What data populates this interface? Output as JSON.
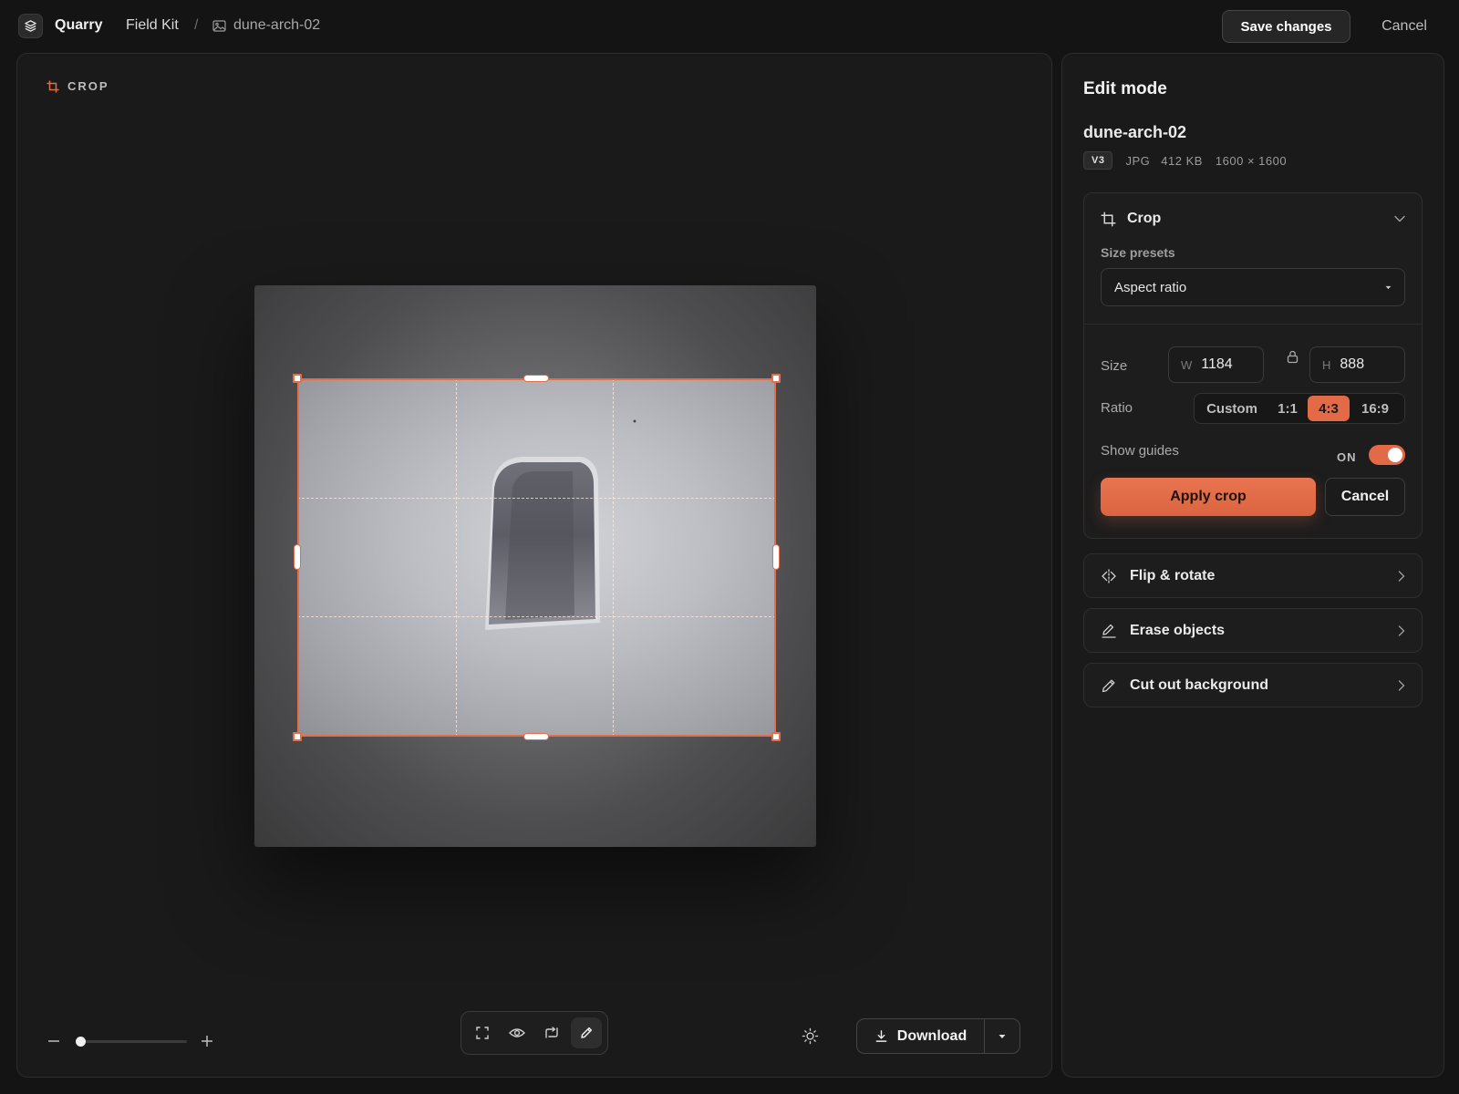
{
  "header": {
    "app_name": "Quarry",
    "project": "Field Kit",
    "separator": "/",
    "file": "dune-arch-02",
    "save_label": "Save changes",
    "cancel_label": "Cancel"
  },
  "canvas": {
    "mode_label": "CROP",
    "zoom_level": 0.0,
    "toolbar": [
      {
        "icon": "fit-screen-icon",
        "active": false
      },
      {
        "icon": "eye-icon",
        "active": false
      },
      {
        "icon": "compare-icon",
        "active": false
      },
      {
        "icon": "pen-icon",
        "active": true
      }
    ],
    "download_label": "Download"
  },
  "panel": {
    "title": "Edit mode",
    "file_name": "dune-arch-02",
    "version": "V3",
    "format": "JPG",
    "size": "412 KB",
    "dimensions": "1600 × 1600",
    "crop": {
      "title": "Crop",
      "presets_label": "Size presets",
      "preset_value": "Aspect ratio",
      "size_label": "Size",
      "width_prefix": "W",
      "width": "1184",
      "height_prefix": "H",
      "height": "888",
      "ratio_label": "Ratio",
      "ratios": [
        "Custom",
        "1:1",
        "4:3",
        "16:9"
      ],
      "selected_ratio": "4:3",
      "guides_label": "Show guides",
      "guides_state": "ON",
      "apply_label": "Apply crop",
      "cancel_label": "Cancel"
    },
    "tools": [
      {
        "label": "Flip & rotate",
        "icon": "flip-icon"
      },
      {
        "label": "Erase objects",
        "icon": "eraser-icon"
      },
      {
        "label": "Cut out background",
        "icon": "pencil-icon"
      }
    ]
  },
  "colors": {
    "accent": "#e26a46",
    "background": "#141414",
    "panel": "#1a1a1a"
  }
}
